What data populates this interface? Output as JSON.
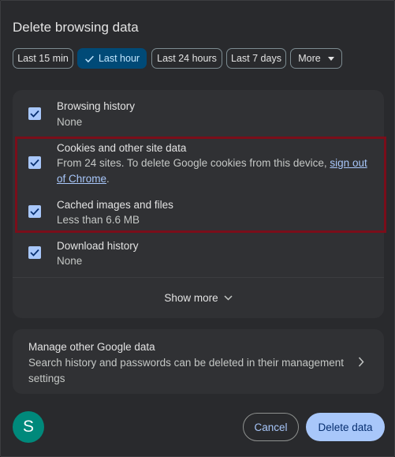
{
  "dialog": {
    "title": "Delete browsing data"
  },
  "time_range": {
    "options": [
      "Last 15 min",
      "Last hour",
      "Last 24 hours",
      "Last 7 days"
    ],
    "selected": "Last hour",
    "more_label": "More"
  },
  "data_types": [
    {
      "title": "Browsing history",
      "subtitle": "None",
      "checked": true
    },
    {
      "title": "Cookies and other site data",
      "subtitle": "From 24 sites. To delete Google cookies from this device, ",
      "link_text": "sign out of Chrome",
      "subtitle_end": ".",
      "checked": true
    },
    {
      "title": "Cached images and files",
      "subtitle": "Less than 6.6 MB",
      "checked": true
    },
    {
      "title": "Download history",
      "subtitle": "None",
      "checked": true
    }
  ],
  "show_more_label": "Show more",
  "manage": {
    "title": "Manage other Google data",
    "subtitle": "Search history and passwords can be deleted in their management settings"
  },
  "account": {
    "avatar_letter": "S",
    "avatar_color": "#00897b"
  },
  "footer": {
    "cancel_label": "Cancel",
    "delete_label": "Delete data"
  },
  "colors": {
    "accent": "#a8c7fa",
    "selected_chip": "#004a77",
    "highlight_box": "#7a0e1a"
  }
}
